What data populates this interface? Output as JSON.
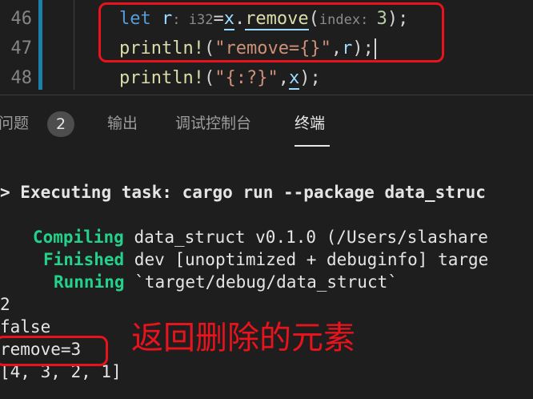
{
  "editor": {
    "lines": [
      {
        "number": "46",
        "tokens": {
          "let": "let",
          "var_r": "r",
          "type_hint": ": i32",
          "eq": "=",
          "var_x": "x",
          "dot": ".",
          "method": "remove",
          "paren_open": "(",
          "param_hint": "index: ",
          "arg": "3",
          "paren_close": ");"
        }
      },
      {
        "number": "47",
        "tokens": {
          "macro": "println!",
          "paren_open": "(",
          "str": "\"remove={}\"",
          "comma": ",",
          "var_r": "r",
          "paren_close": ");"
        }
      },
      {
        "number": "48",
        "tokens": {
          "macro": "println!",
          "paren_open": "(",
          "str": "\"{:?}\"",
          "comma": ",",
          "var_x": "x",
          "paren_close": ");"
        }
      }
    ]
  },
  "panel": {
    "tabs": [
      {
        "label": "问题",
        "badge": "2"
      },
      {
        "label": "输出"
      },
      {
        "label": "调试控制台"
      },
      {
        "label": "终端",
        "active": true
      }
    ]
  },
  "terminal": {
    "task_prefix": "> ",
    "task_text": "Executing task: cargo run --package data_struc",
    "build_lines": [
      {
        "status": "Compiling",
        "text": " data_struct v0.1.0 (/Users/slashare"
      },
      {
        "status": "Finished",
        "text": " dev [unoptimized + debuginfo] targe"
      },
      {
        "status": "Running",
        "text": " `target/debug/data_struct`"
      }
    ],
    "output_lines": [
      "2",
      "false",
      "remove=3",
      "[4, 3, 2, 1]"
    ]
  },
  "annotation": {
    "text": "返回删除的元素",
    "color": "#e8131c"
  },
  "colors": {
    "background": "#1e1e1e",
    "keyword": "#569cd6",
    "variable": "#9cdcfe",
    "function": "#dcdcaa",
    "string": "#ce9178",
    "number": "#b5cea8",
    "terminal_green": "#23d18b",
    "gutter_modified": "#1b81a8"
  }
}
